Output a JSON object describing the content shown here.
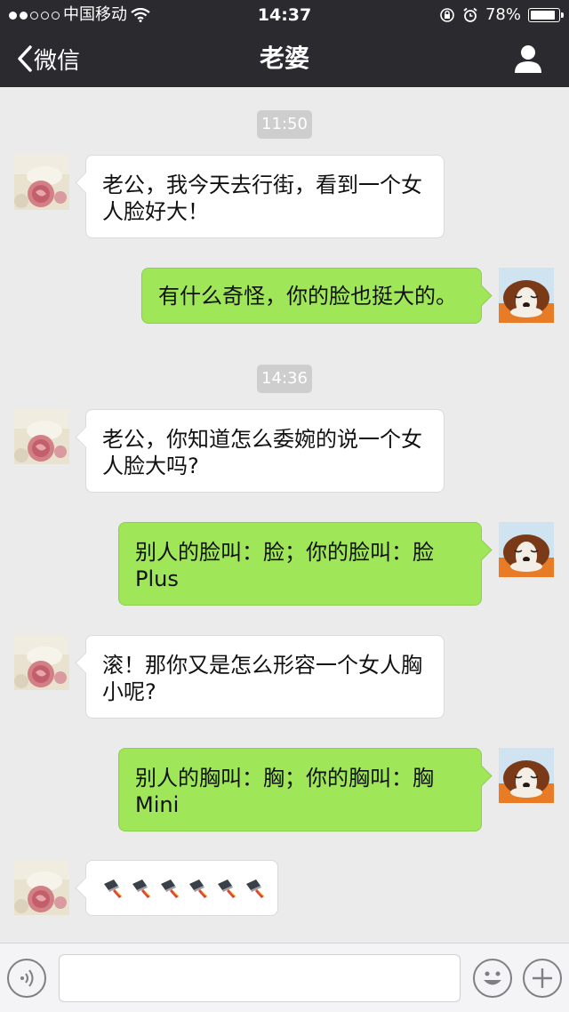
{
  "status_bar": {
    "carrier": "中国移动",
    "time": "14:37",
    "battery": "78%",
    "battery_level": 0.78
  },
  "nav": {
    "back_label": "微信",
    "title": "老婆",
    "profile_icon": "person-icon"
  },
  "messages": [
    {
      "type": "time",
      "text": "11:50"
    },
    {
      "type": "msg",
      "side": "left",
      "lines": [
        "老公，我今天去行街，看到一个女",
        "人脸好大！"
      ]
    },
    {
      "type": "msg",
      "side": "right",
      "lines": [
        "有什么奇怪，你的脸也挺大的。"
      ]
    },
    {
      "type": "time",
      "text": "14:36"
    },
    {
      "type": "msg",
      "side": "left",
      "lines": [
        "老公，你知道怎么委婉的说一个女",
        "人脸大吗?"
      ]
    },
    {
      "type": "msg",
      "side": "right",
      "lines": [
        "别人的脸叫：脸；你的脸叫：脸",
        "Plus"
      ]
    },
    {
      "type": "msg",
      "side": "left",
      "lines": [
        "滚！那你又是怎么形容一个女人胸",
        "小呢?"
      ]
    },
    {
      "type": "msg",
      "side": "right",
      "lines": [
        "别人的胸叫：胸；你的胸叫：胸",
        "Mini"
      ]
    },
    {
      "type": "msg",
      "side": "left",
      "emoji": "kitchen-knife-icon",
      "emoji_count": 6
    }
  ],
  "input": {
    "voice_icon": "voice-icon",
    "emoji_icon": "smiley-icon",
    "plus_icon": "plus-icon",
    "value": ""
  }
}
